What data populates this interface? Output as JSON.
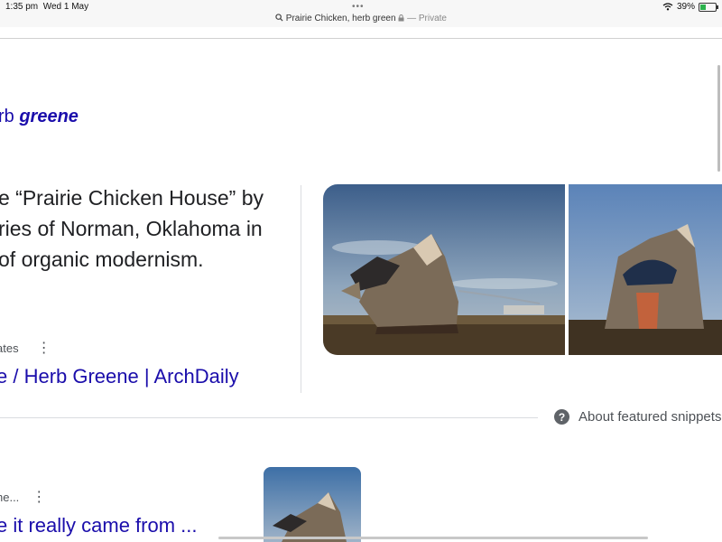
{
  "status_bar": {
    "time": "1:35 pm",
    "date": "Wed 1 May",
    "dots": "•••",
    "url": "Prairie Chicken, herb green",
    "private_label": "— Private",
    "battery": "39%",
    "battery_level": 0.39
  },
  "result1": {
    "title_plain": "rb ",
    "title_bold": "greene",
    "snippet_lines": [
      "e “Prairie Chicken House” by",
      "ries of Norman, Oklahoma in",
      "of organic modernism."
    ],
    "source": "ates",
    "link_text": "e / Herb Greene | ArchDaily"
  },
  "about_snippets": "About featured snippets",
  "result2": {
    "source": "he...",
    "link_text": "e it really came from ..."
  },
  "icons": [
    "search-icon",
    "lock-icon",
    "wifi-icon",
    "battery-icon",
    "more-vert-icon",
    "help-icon"
  ],
  "colors": {
    "link": "#1a0dab",
    "text": "#202124",
    "muted": "#4d5156"
  }
}
